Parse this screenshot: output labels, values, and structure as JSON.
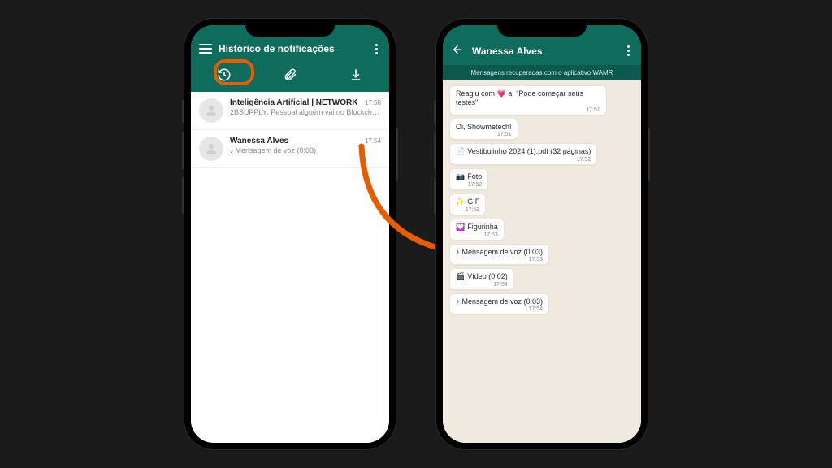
{
  "left": {
    "header_title": "Histórico de notificações",
    "items": [
      {
        "title": "Inteligência Artificial | NETWORK",
        "subtitle": "2BSUPPLY: Pessoal alguém vai no Blockchain ...",
        "time": "17:58",
        "icon": ""
      },
      {
        "title": "Wanessa Alves",
        "subtitle": "Mensagem de voz (0:03)",
        "time": "17:54",
        "icon": "♪"
      }
    ]
  },
  "right": {
    "chat_name": "Wanessa Alves",
    "banner": "Mensagens recuperadas com o aplicativo WAMR",
    "messages": [
      {
        "text": "Reagiu com 💗 a: \"Pode começar seus testes\"",
        "time": "17:51",
        "emoji": ""
      },
      {
        "text": "Oi, Showmetech!",
        "time": "17:51",
        "emoji": ""
      },
      {
        "text": "Vestibulinho 2024 (1).pdf (32 páginas)",
        "time": "17:52",
        "emoji": "📄"
      },
      {
        "text": "Foto",
        "time": "17:52",
        "emoji": "📷"
      },
      {
        "text": "GIF",
        "time": "17:53",
        "emoji": "✨"
      },
      {
        "text": "Figurinha",
        "time": "17:53",
        "emoji": "💟"
      },
      {
        "text": "Mensagem de voz (0:03)",
        "time": "17:53",
        "emoji": "♪"
      },
      {
        "text": "Vídeo (0:02)",
        "time": "17:54",
        "emoji": "🎬"
      },
      {
        "text": "Mensagem de voz (0:03)",
        "time": "17:54",
        "emoji": "♪"
      }
    ]
  }
}
